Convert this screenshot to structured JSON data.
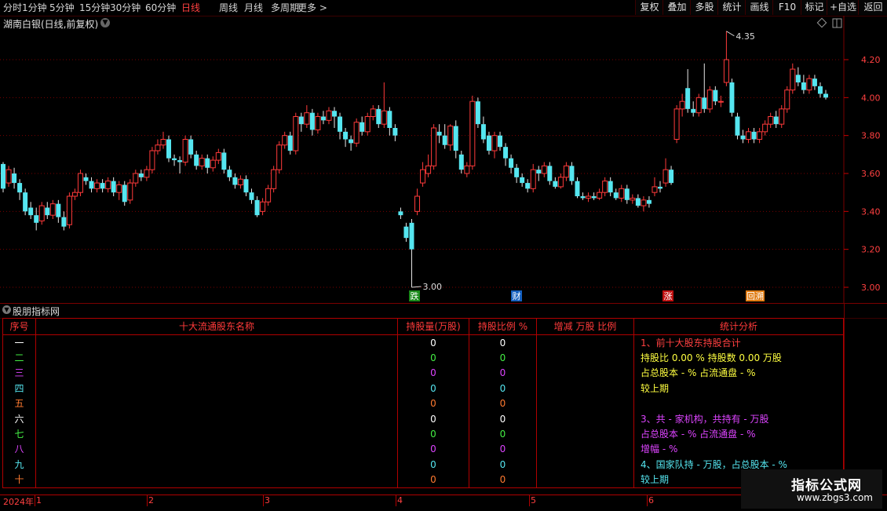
{
  "toolbar": {
    "left_items": [
      "分时",
      "1分钟",
      "5分钟",
      "15分钟",
      "30分钟",
      "60分钟",
      "日线",
      "周线",
      "月线",
      "多周期",
      "更多 >"
    ],
    "active_index": 6,
    "right_items": [
      "复权",
      "叠加",
      "多股",
      "统计",
      "画线",
      "F10",
      "标记",
      "+自选",
      "返回"
    ]
  },
  "chart": {
    "title": "湖南白银(日线,前复权)",
    "high_label": "4.35",
    "low_label": "3.00",
    "price_ticks": [
      "4.20",
      "4.00",
      "3.80",
      "3.60",
      "3.40",
      "3.20",
      "3.00"
    ],
    "markers": [
      {
        "text": "跌",
        "color": "#1a8a1a"
      },
      {
        "text": "财",
        "color": "#1560c0"
      },
      {
        "text": "涨",
        "color": "#c01010"
      },
      {
        "text": "回溯",
        "color": "#e07a10"
      }
    ],
    "colors": {
      "up": "#ff3a3a",
      "down": "#55e6f0",
      "grid": "#7a0000"
    }
  },
  "chart_data": {
    "type": "candlestick",
    "ylim": [
      2.95,
      4.45
    ],
    "y_ticks": [
      3.0,
      3.2,
      3.4,
      3.6,
      3.8,
      4.0,
      4.2
    ],
    "candles": [
      [
        3.65,
        3.52,
        3.66,
        3.5
      ],
      [
        3.55,
        3.62,
        3.64,
        3.53
      ],
      [
        3.6,
        3.55,
        3.63,
        3.52
      ],
      [
        3.55,
        3.5,
        3.57,
        3.46
      ],
      [
        3.5,
        3.4,
        3.52,
        3.38
      ],
      [
        3.42,
        3.38,
        3.45,
        3.36
      ],
      [
        3.38,
        3.34,
        3.42,
        3.3
      ],
      [
        3.35,
        3.43,
        3.45,
        3.33
      ],
      [
        3.42,
        3.38,
        3.45,
        3.36
      ],
      [
        3.38,
        3.44,
        3.46,
        3.36
      ],
      [
        3.44,
        3.37,
        3.46,
        3.34
      ],
      [
        3.37,
        3.32,
        3.4,
        3.3
      ],
      [
        3.33,
        3.48,
        3.5,
        3.31
      ],
      [
        3.48,
        3.5,
        3.52,
        3.46
      ],
      [
        3.5,
        3.6,
        3.62,
        3.48
      ],
      [
        3.58,
        3.56,
        3.6,
        3.54
      ],
      [
        3.56,
        3.52,
        3.58,
        3.5
      ],
      [
        3.52,
        3.55,
        3.57,
        3.5
      ],
      [
        3.55,
        3.52,
        3.57,
        3.5
      ],
      [
        3.52,
        3.56,
        3.58,
        3.5
      ],
      [
        3.56,
        3.5,
        3.58,
        3.48
      ],
      [
        3.5,
        3.54,
        3.56,
        3.46
      ],
      [
        3.54,
        3.45,
        3.56,
        3.43
      ],
      [
        3.46,
        3.55,
        3.57,
        3.44
      ],
      [
        3.55,
        3.6,
        3.62,
        3.53
      ],
      [
        3.6,
        3.58,
        3.62,
        3.56
      ],
      [
        3.58,
        3.62,
        3.64,
        3.56
      ],
      [
        3.62,
        3.72,
        3.74,
        3.6
      ],
      [
        3.72,
        3.75,
        3.78,
        3.7
      ],
      [
        3.75,
        3.78,
        3.82,
        3.73
      ],
      [
        3.78,
        3.68,
        3.8,
        3.66
      ],
      [
        3.68,
        3.67,
        3.7,
        3.64
      ],
      [
        3.67,
        3.66,
        3.69,
        3.6
      ],
      [
        3.66,
        3.78,
        3.8,
        3.64
      ],
      [
        3.78,
        3.7,
        3.8,
        3.68
      ],
      [
        3.7,
        3.64,
        3.72,
        3.62
      ],
      [
        3.64,
        3.68,
        3.7,
        3.62
      ],
      [
        3.68,
        3.63,
        3.7,
        3.6
      ],
      [
        3.63,
        3.67,
        3.69,
        3.61
      ],
      [
        3.67,
        3.71,
        3.73,
        3.65
      ],
      [
        3.71,
        3.62,
        3.73,
        3.6
      ],
      [
        3.62,
        3.58,
        3.64,
        3.56
      ],
      [
        3.58,
        3.54,
        3.6,
        3.52
      ],
      [
        3.54,
        3.57,
        3.59,
        3.52
      ],
      [
        3.57,
        3.5,
        3.59,
        3.48
      ],
      [
        3.5,
        3.46,
        3.52,
        3.44
      ],
      [
        3.46,
        3.38,
        3.48,
        3.37
      ],
      [
        3.4,
        3.45,
        3.47,
        3.38
      ],
      [
        3.45,
        3.52,
        3.54,
        3.43
      ],
      [
        3.52,
        3.62,
        3.64,
        3.5
      ],
      [
        3.62,
        3.75,
        3.77,
        3.6
      ],
      [
        3.75,
        3.8,
        3.82,
        3.73
      ],
      [
        3.8,
        3.72,
        3.82,
        3.7
      ],
      [
        3.72,
        3.9,
        3.92,
        3.7
      ],
      [
        3.9,
        3.86,
        3.92,
        3.82
      ],
      [
        3.86,
        3.92,
        3.96,
        3.84
      ],
      [
        3.92,
        3.83,
        3.94,
        3.8
      ],
      [
        3.83,
        3.9,
        3.92,
        3.81
      ],
      [
        3.9,
        3.88,
        3.93,
        3.86
      ],
      [
        3.88,
        3.93,
        3.95,
        3.86
      ],
      [
        3.93,
        3.9,
        3.95,
        3.84
      ],
      [
        3.9,
        3.82,
        3.92,
        3.78
      ],
      [
        3.82,
        3.78,
        3.84,
        3.74
      ],
      [
        3.78,
        3.76,
        3.8,
        3.72
      ],
      [
        3.76,
        3.87,
        3.89,
        3.74
      ],
      [
        3.87,
        3.82,
        3.9,
        3.8
      ],
      [
        3.82,
        3.9,
        3.92,
        3.8
      ],
      [
        3.9,
        3.94,
        3.96,
        3.88
      ],
      [
        3.94,
        3.86,
        3.96,
        3.84
      ],
      [
        3.86,
        3.93,
        4.08,
        3.84
      ],
      [
        3.93,
        3.84,
        3.95,
        3.8
      ],
      [
        3.84,
        3.8,
        3.86,
        3.77
      ],
      [
        3.4,
        3.38,
        3.42,
        3.36
      ],
      [
        3.32,
        3.26,
        3.34,
        3.24
      ],
      [
        3.34,
        3.2,
        3.36,
        3.0
      ],
      [
        3.4,
        3.48,
        3.52,
        3.38
      ],
      [
        3.55,
        3.62,
        3.66,
        3.53
      ],
      [
        3.6,
        3.64,
        3.7,
        3.58
      ],
      [
        3.64,
        3.84,
        3.86,
        3.62
      ],
      [
        3.82,
        3.8,
        3.86,
        3.76
      ],
      [
        3.8,
        3.75,
        3.86,
        3.73
      ],
      [
        3.75,
        3.85,
        3.86,
        3.72
      ],
      [
        3.85,
        3.72,
        3.88,
        3.68
      ],
      [
        3.7,
        3.62,
        3.72,
        3.6
      ],
      [
        3.6,
        3.64,
        3.66,
        3.58
      ],
      [
        3.64,
        3.98,
        4.01,
        3.62
      ],
      [
        3.98,
        3.86,
        4.0,
        3.84
      ],
      [
        3.86,
        3.78,
        3.9,
        3.76
      ],
      [
        3.8,
        3.72,
        3.82,
        3.7
      ],
      [
        3.72,
        3.8,
        3.82,
        3.68
      ],
      [
        3.8,
        3.74,
        3.82,
        3.72
      ],
      [
        3.74,
        3.68,
        3.76,
        3.64
      ],
      [
        3.68,
        3.63,
        3.7,
        3.6
      ],
      [
        3.63,
        3.58,
        3.65,
        3.55
      ],
      [
        3.58,
        3.55,
        3.6,
        3.53
      ],
      [
        3.55,
        3.52,
        3.57,
        3.5
      ],
      [
        3.52,
        3.62,
        3.65,
        3.5
      ],
      [
        3.62,
        3.6,
        3.64,
        3.56
      ],
      [
        3.6,
        3.64,
        3.66,
        3.58
      ],
      [
        3.64,
        3.56,
        3.66,
        3.54
      ],
      [
        3.56,
        3.53,
        3.58,
        3.52
      ],
      [
        3.53,
        3.58,
        3.6,
        3.52
      ],
      [
        3.58,
        3.64,
        3.66,
        3.56
      ],
      [
        3.64,
        3.56,
        3.66,
        3.54
      ],
      [
        3.56,
        3.48,
        3.58,
        3.47
      ],
      [
        3.48,
        3.47,
        3.5,
        3.46
      ],
      [
        3.47,
        3.48,
        3.5,
        3.45
      ],
      [
        3.48,
        3.47,
        3.5,
        3.46
      ],
      [
        3.47,
        3.5,
        3.52,
        3.46
      ],
      [
        3.5,
        3.56,
        3.58,
        3.48
      ],
      [
        3.56,
        3.5,
        3.58,
        3.48
      ],
      [
        3.5,
        3.47,
        3.52,
        3.46
      ],
      [
        3.47,
        3.52,
        3.54,
        3.45
      ],
      [
        3.52,
        3.46,
        3.54,
        3.44
      ],
      [
        3.46,
        3.47,
        3.49,
        3.44
      ],
      [
        3.47,
        3.43,
        3.49,
        3.42
      ],
      [
        3.43,
        3.46,
        3.48,
        3.4
      ],
      [
        3.46,
        3.44,
        3.48,
        3.42
      ],
      [
        3.5,
        3.53,
        3.58,
        3.48
      ],
      [
        3.53,
        3.52,
        3.56,
        3.5
      ],
      [
        3.55,
        3.62,
        3.68,
        3.53
      ],
      [
        3.62,
        3.55,
        3.64,
        3.54
      ],
      [
        3.78,
        3.94,
        3.96,
        3.76
      ],
      [
        3.94,
        3.98,
        4.02,
        3.9
      ],
      [
        4.05,
        3.94,
        4.15,
        3.92
      ],
      [
        3.94,
        3.92,
        3.98,
        3.9
      ],
      [
        3.92,
        4.0,
        4.02,
        3.9
      ],
      [
        4.0,
        3.94,
        4.18,
        3.92
      ],
      [
        3.94,
        4.04,
        4.06,
        3.92
      ],
      [
        4.04,
        3.98,
        4.06,
        3.96
      ],
      [
        3.98,
        3.98,
        4.01,
        3.95
      ],
      [
        4.08,
        4.2,
        4.35,
        4.06
      ],
      [
        4.08,
        3.92,
        4.1,
        3.9
      ],
      [
        3.9,
        3.8,
        3.92,
        3.78
      ],
      [
        3.8,
        3.78,
        3.83,
        3.76
      ],
      [
        3.78,
        3.82,
        3.84,
        3.76
      ],
      [
        3.82,
        3.78,
        3.84,
        3.76
      ],
      [
        3.78,
        3.82,
        3.84,
        3.76
      ],
      [
        3.82,
        3.86,
        3.88,
        3.8
      ],
      [
        3.86,
        3.9,
        3.92,
        3.84
      ],
      [
        3.9,
        3.86,
        3.93,
        3.84
      ],
      [
        3.86,
        3.94,
        3.96,
        3.84
      ],
      [
        3.94,
        4.04,
        4.06,
        3.92
      ],
      [
        4.04,
        4.15,
        4.18,
        4.02
      ],
      [
        4.12,
        4.08,
        4.16,
        4.06
      ],
      [
        4.08,
        4.04,
        4.12,
        4.02
      ],
      [
        4.04,
        4.1,
        4.12,
        4.02
      ],
      [
        4.1,
        4.06,
        4.12,
        4.04
      ],
      [
        4.06,
        4.02,
        4.08,
        4.0
      ],
      [
        4.02,
        4.0,
        4.04,
        3.99
      ]
    ]
  },
  "panel": {
    "title": "股朋指标网",
    "headers": [
      "序号",
      "十大流通股东名称",
      "持股量(万股)",
      "持股比例 %",
      "增减 万股 比例",
      "统计分析"
    ],
    "rows": [
      {
        "seq": "一",
        "color": "#ffffff",
        "qty": "0",
        "pct": "0"
      },
      {
        "seq": "二",
        "color": "#44ee44",
        "qty": "0",
        "pct": "0"
      },
      {
        "seq": "三",
        "color": "#dd44ff",
        "qty": "0",
        "pct": "0"
      },
      {
        "seq": "四",
        "color": "#55e6f0",
        "qty": "0",
        "pct": "0"
      },
      {
        "seq": "五",
        "color": "#ff7a30",
        "qty": "0",
        "pct": "0"
      },
      {
        "seq": "六",
        "color": "#ffffff",
        "qty": "0",
        "pct": "0"
      },
      {
        "seq": "七",
        "color": "#44ee44",
        "qty": "0",
        "pct": "0"
      },
      {
        "seq": "八",
        "color": "#dd44ff",
        "qty": "0",
        "pct": "0"
      },
      {
        "seq": "九",
        "color": "#55e6f0",
        "qty": "0",
        "pct": "0"
      },
      {
        "seq": "十",
        "color": "#ff7a30",
        "qty": "0",
        "pct": "0"
      }
    ],
    "stats": [
      {
        "text": "1、前十大股东持股合计",
        "color": "#ff4040"
      },
      {
        "text": " 持股比 0.00 %   持股数 0.00 万股",
        "color": "#ffff40"
      },
      {
        "text": " 占总股本 - %   占流通盘 - %",
        "color": "#ffff40"
      },
      {
        "text": " 较上期",
        "color": "#ffff40"
      },
      {
        "text": "",
        "color": "#ffff40"
      },
      {
        "text": "3、共 - 家机构，共持有 - 万股",
        "color": "#dd44ff"
      },
      {
        "text": " 占总股本 - %   占流通盘 - %",
        "color": "#dd44ff"
      },
      {
        "text": " 增幅 - %",
        "color": "#dd44ff"
      },
      {
        "text": "4、国家队持 - 万股，占总股本 - %",
        "color": "#55e6f0"
      },
      {
        "text": " 较上期",
        "color": "#55e6f0"
      }
    ]
  },
  "timeline": {
    "labels": [
      "2024年",
      "1",
      "2",
      "3",
      "4",
      "5",
      "6"
    ]
  },
  "watermark": {
    "title": "指标公式网",
    "url": "www.zbgs3.com"
  }
}
